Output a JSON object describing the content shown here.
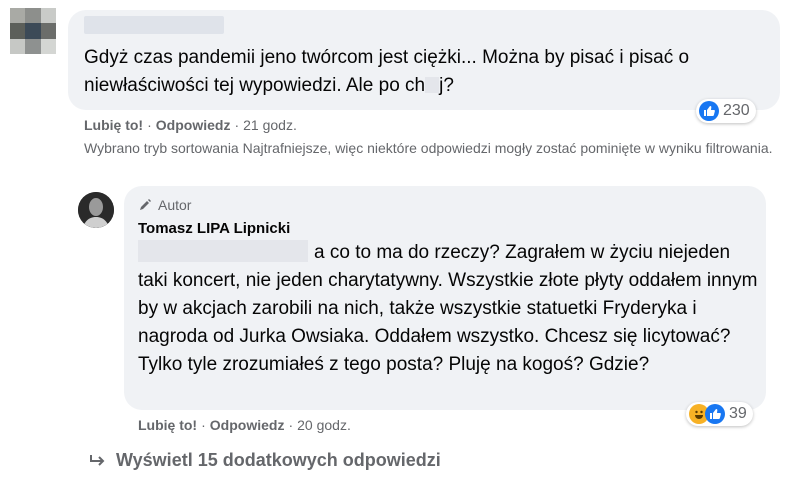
{
  "comment1": {
    "text_before": "Gdyż czas pandemii jeno twórcom jest ciężki... Można by pisać i pisać o niewłaściwości tej wypowiedzi. Ale po ch",
    "text_after": "j?",
    "reaction_count": "230",
    "actions": {
      "like": "Lubię to!",
      "reply": "Odpowiedz",
      "time": "21 godz."
    }
  },
  "sort_note": "Wybrano tryb sortowania Najtrafniejsze, więc niektóre odpowiedzi mogły zostać pominięte w wyniku filtrowania.",
  "reply1": {
    "badge": "Autor",
    "author": "Tomasz LIPA Lipnicki",
    "text": "a co to ma do rzeczy? Zagrałem w życiu niejeden taki koncert, nie jeden charytatywny. Wszystkie złote płyty oddałem innym by w akcjach zarobili na nich, także wszystkie statuetki Fryderyka i nagroda od Jurka Owsiaka. Oddałem wszystko. Chcesz się licytować? Tylko tyle zrozumiałeś z tego posta? Pluję na kogoś? Gdzie?",
    "reaction_count": "39",
    "actions": {
      "like": "Lubię to!",
      "reply": "Odpowiedz",
      "time": "20 godz."
    }
  },
  "more_replies": "Wyświetl 15 dodatkowych odpowiedzi"
}
